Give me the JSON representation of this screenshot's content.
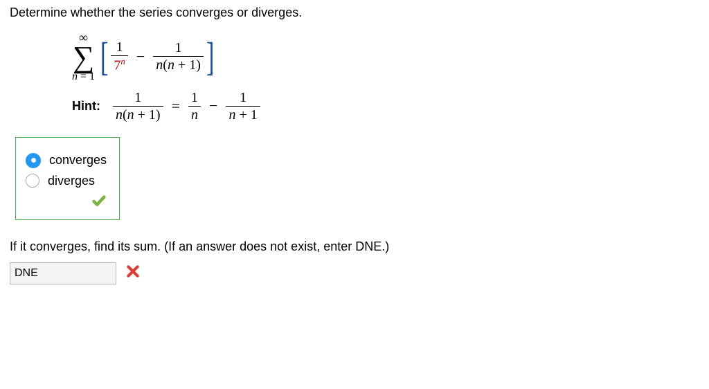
{
  "question": "Determine whether the series converges or diverges.",
  "series": {
    "sigma_top": "∞",
    "sigma_bottom_n": "n",
    "sigma_bottom_eq": " = 1",
    "frac1_num": "1",
    "frac1_den_base": "7",
    "frac1_den_exp": "n",
    "minus": "−",
    "frac2_num": "1",
    "frac2_den_n1": "n",
    "frac2_den_paren_open": "(",
    "frac2_den_n2": "n",
    "frac2_den_plus1": " + 1)"
  },
  "hint": {
    "label": "Hint:",
    "lhs_num": "1",
    "lhs_den_n1": "n",
    "lhs_den_paren_open": "(",
    "lhs_den_n2": "n",
    "lhs_den_plus1": " + 1)",
    "eq": "=",
    "r1_num": "1",
    "r1_den": "n",
    "minus": "−",
    "r2_num": "1",
    "r2_den_n": "n",
    "r2_den_plus1": " + 1"
  },
  "options": {
    "a": "converges",
    "b": "diverges"
  },
  "part2_text": "If it converges, find its sum. (If an answer does not exist, enter DNE.)",
  "input_value": "DNE"
}
